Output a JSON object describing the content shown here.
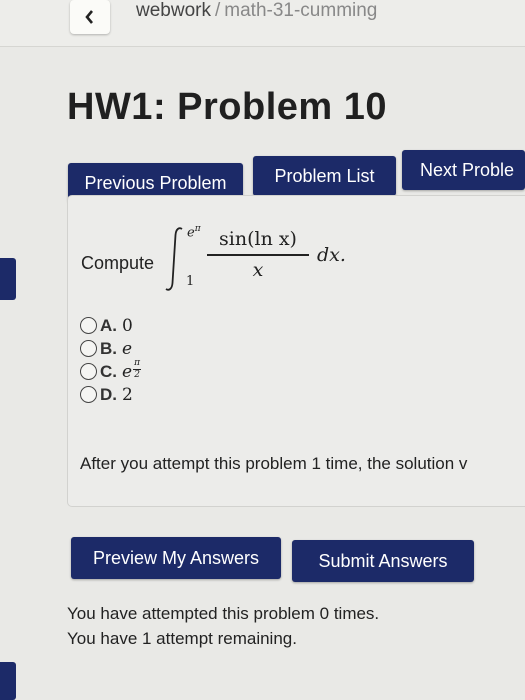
{
  "header": {
    "back_icon": "chevron-left-icon",
    "breadcrumb": {
      "site": "webwork",
      "separator": "/",
      "course": "math-31-cumming"
    }
  },
  "page": {
    "title": "HW1: Problem 10"
  },
  "nav": {
    "previous": "Previous Problem",
    "list": "Problem List",
    "next": "Next Proble"
  },
  "problem": {
    "compute_label": "Compute",
    "integral": {
      "upper_base": "e",
      "upper_exp": "π",
      "lower": "1",
      "numerator": "sin(ln x)",
      "denominator": "x",
      "differential": "dx."
    },
    "choices": [
      {
        "letter": "A.",
        "value": "0"
      },
      {
        "letter": "B.",
        "value": "e"
      },
      {
        "letter": "C.",
        "base": "e",
        "exp_num": "π",
        "exp_den": "2"
      },
      {
        "letter": "D.",
        "value": "2"
      }
    ],
    "solution_note": "After you attempt this problem 1 time, the solution v"
  },
  "actions": {
    "preview": "Preview My Answers",
    "submit": "Submit Answers"
  },
  "status": {
    "attempted": "You have attempted this problem 0 times.",
    "remaining": "You have 1 attempt remaining."
  },
  "colors": {
    "primary": "#1c2a68",
    "background": "#e9e9e6"
  }
}
